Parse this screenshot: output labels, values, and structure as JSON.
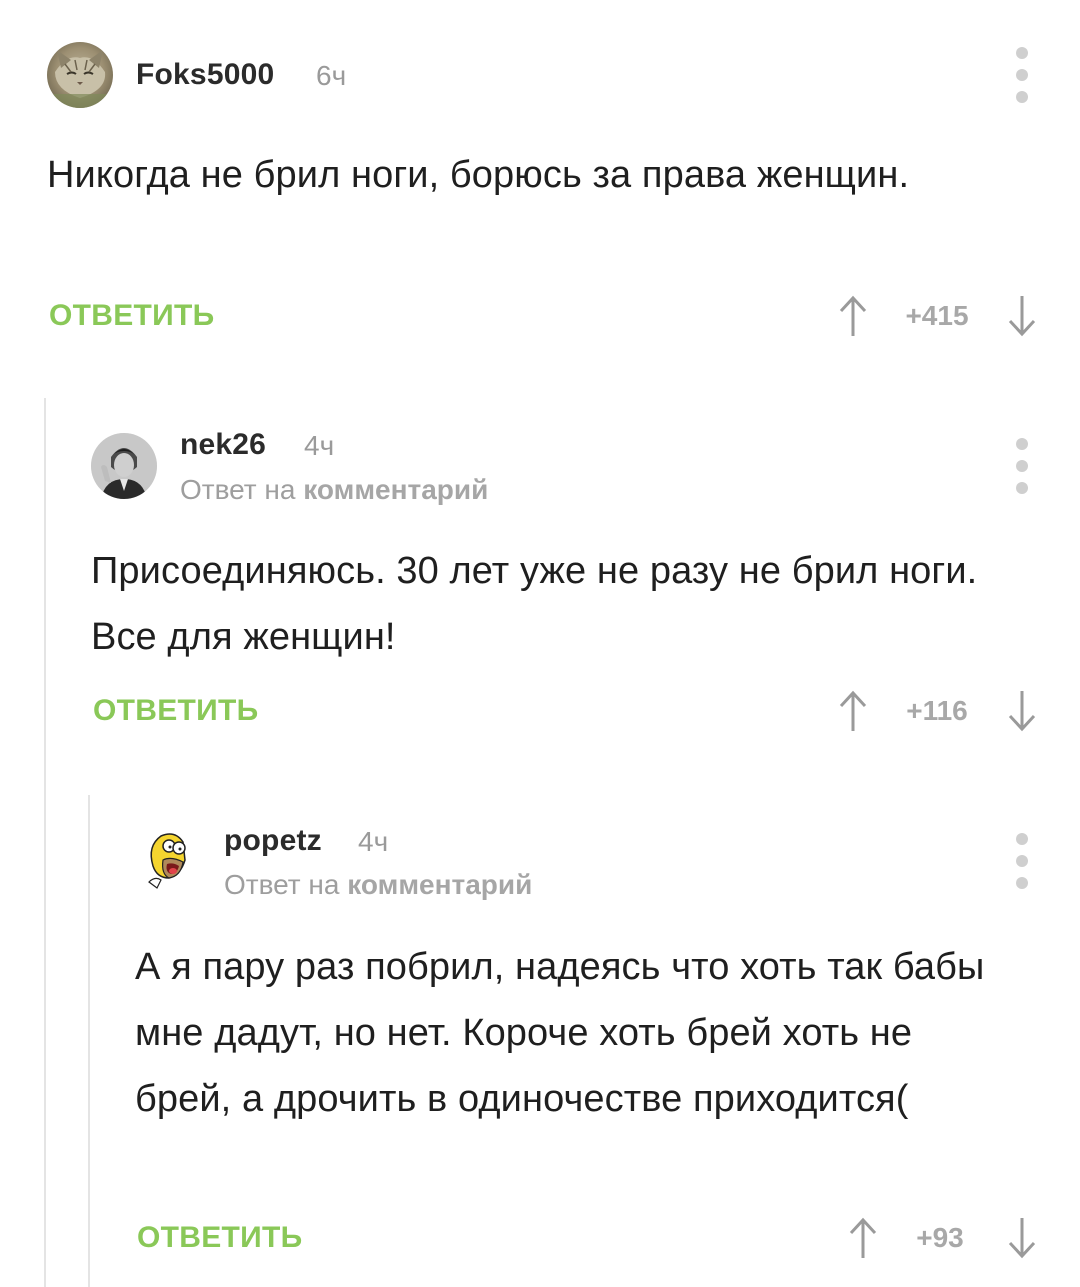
{
  "comments": [
    {
      "username": "Foks5000",
      "time": "6ч",
      "text": "Никогда не брил ноги, борюсь за права женщин.",
      "reply_label": "ОТВЕТИТЬ",
      "rating": "+415"
    },
    {
      "username": "nek26",
      "time": "4ч",
      "reply_to_prefix": "Ответ на",
      "reply_to_link": "комментарий",
      "text": "Присоединяюсь. 30 лет уже не разу не брил ноги. Все для женщин!",
      "reply_label": "ОТВЕТИТЬ",
      "rating": "+116"
    },
    {
      "username": "popetz",
      "time": "4ч",
      "reply_to_prefix": "Ответ на",
      "reply_to_link": "комментарий",
      "text": "А я пару раз побрил, надеясь что хоть так бабы мне дадут, но нет. Короче хоть брей хоть не брей, а дрочить в одиночестве приходится(",
      "reply_label": "ОТВЕТИТЬ",
      "rating": "+93"
    }
  ],
  "colors": {
    "accent": "#8ac858",
    "muted": "#a8a8a8",
    "thread_line": "#e4e4e4"
  },
  "icons": [
    "more-vertical-icon",
    "arrow-up-icon",
    "arrow-down-icon"
  ]
}
